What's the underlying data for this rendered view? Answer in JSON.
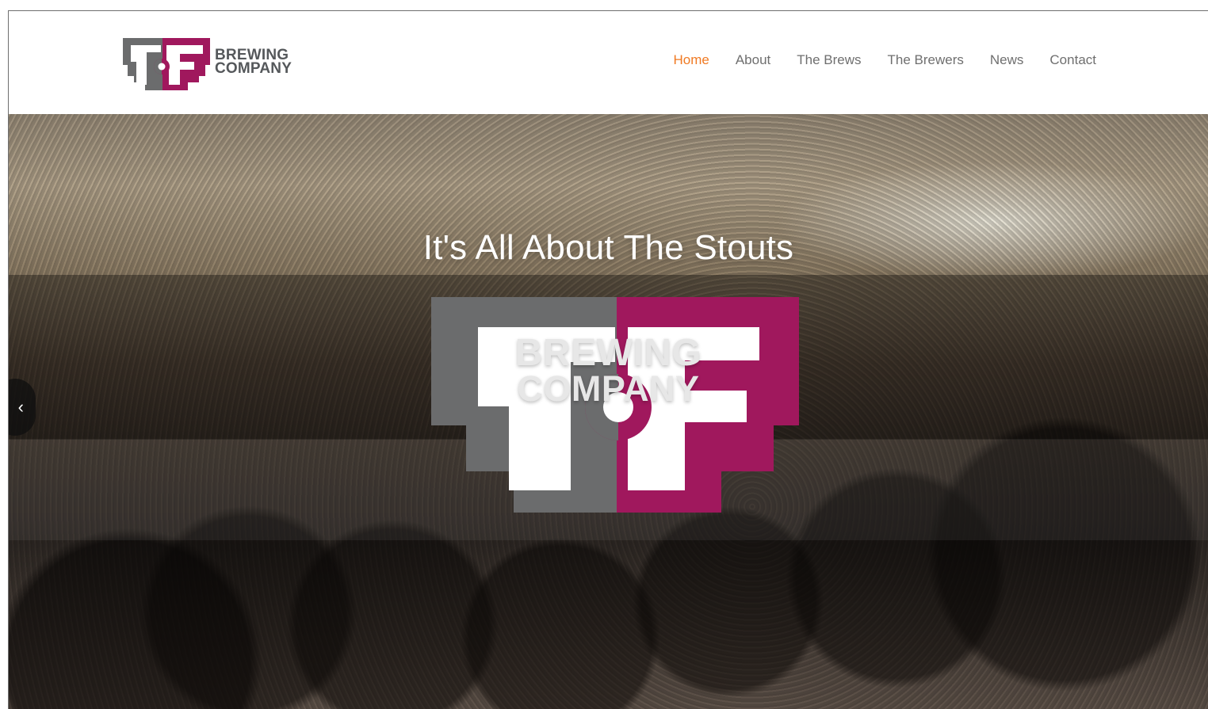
{
  "brand": {
    "line1": "BREWING",
    "line2": "COMPANY"
  },
  "nav": {
    "items": [
      {
        "label": "Home",
        "active": true
      },
      {
        "label": "About",
        "active": false
      },
      {
        "label": "The Brews",
        "active": false
      },
      {
        "label": "The Brewers",
        "active": false
      },
      {
        "label": "News",
        "active": false
      },
      {
        "label": "Contact",
        "active": false
      }
    ]
  },
  "hero": {
    "headline": "It's All About The Stouts",
    "logo_word_1": "BREWING",
    "logo_word_2": "COMPANY",
    "prev_arrow": "‹"
  },
  "colors": {
    "accent": "#f07a23",
    "nav_text": "#6f6f6f",
    "logo_gray": "#6b6c6d",
    "logo_magenta": "#a0185d"
  },
  "icons": {
    "prev": "chevron-left-icon"
  }
}
